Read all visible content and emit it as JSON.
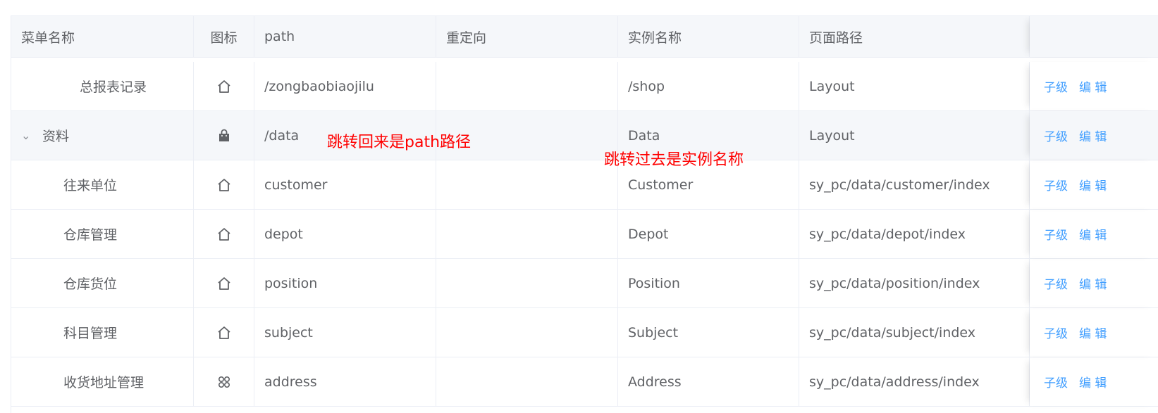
{
  "columns": [
    "菜单名称",
    "图标",
    "path",
    "重定向",
    "实例名称",
    "页面路径"
  ],
  "rows": [
    {
      "name": "总报表记录",
      "icon": "home-icon",
      "path": "/zongbaobiaojilu",
      "redirect": "",
      "component_name": "/shop",
      "page_path": "Layout",
      "expandable": false
    },
    {
      "name": "资料",
      "icon": "shopping-bag-icon",
      "path": "/data",
      "redirect": "",
      "component_name": "Data",
      "page_path": "Layout",
      "expandable": true
    },
    {
      "name": "往来单位",
      "icon": "home-icon",
      "path": "customer",
      "redirect": "",
      "component_name": "Customer",
      "page_path": "sy_pc/data/customer/index",
      "expandable": false
    },
    {
      "name": "仓库管理",
      "icon": "home-icon",
      "path": "depot",
      "redirect": "",
      "component_name": "Depot",
      "page_path": "sy_pc/data/depot/index",
      "expandable": false
    },
    {
      "name": "仓库货位",
      "icon": "home-icon",
      "path": "position",
      "redirect": "",
      "component_name": "Position",
      "page_path": "sy_pc/data/position/index",
      "expandable": false
    },
    {
      "name": "科目管理",
      "icon": "home-icon",
      "path": "subject",
      "redirect": "",
      "component_name": "Subject",
      "page_path": "sy_pc/data/subject/index",
      "expandable": false
    },
    {
      "name": "收货地址管理",
      "icon": "grid-icon",
      "path": "address",
      "redirect": "",
      "component_name": "Address",
      "page_path": "sy_pc/data/address/index",
      "expandable": false
    }
  ],
  "actions": {
    "child": "子级",
    "edit": "编 辑"
  },
  "annotations": {
    "path_note": "跳转回来是path路径",
    "name_note": "跳转过去是实例名称"
  },
  "colors": {
    "link": "#409eff",
    "annotation": "#ff0000",
    "header_bg": "#f5f7fa"
  }
}
